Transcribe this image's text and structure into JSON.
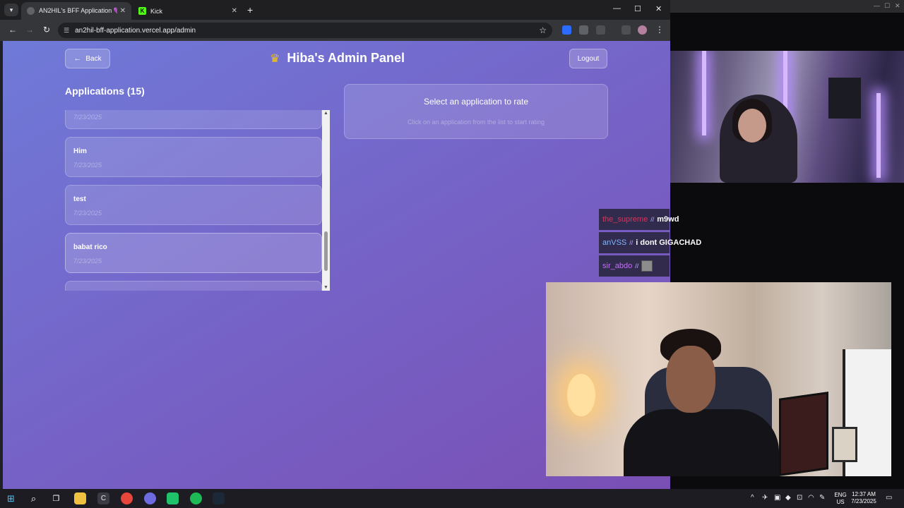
{
  "browser": {
    "tabs": [
      {
        "title": "AN2HIL's BFF Application 💜",
        "active": true
      },
      {
        "title": "Kick",
        "active": false
      }
    ],
    "url": "an2hil-bff-application.vercel.app/admin"
  },
  "page": {
    "back_label": "Back",
    "title": "Hiba's Admin Panel",
    "logout_label": "Logout",
    "applications_heading": "Applications (15)",
    "applications": [
      {
        "name": "",
        "date": "7/23/2025"
      },
      {
        "name": "Him",
        "date": "7/23/2025"
      },
      {
        "name": "test",
        "date": "7/23/2025"
      },
      {
        "name": "babat rico",
        "date": "7/23/2025"
      }
    ],
    "rate_panel": {
      "heading": "Select an application to rate",
      "subtext": "Click on an application from the list to start rating"
    }
  },
  "chat": [
    {
      "user": "the_supreme",
      "user_color": "#e0305a",
      "message": "m9wd"
    },
    {
      "user": "anVSS",
      "user_color": "#7fb7ff",
      "message": "i dont GIGACHAD"
    },
    {
      "user": "sir_abdo",
      "user_color": "#c86bff",
      "message": ""
    }
  ],
  "taskbar": {
    "lang": "ENG",
    "region": "US",
    "time": "12:37 AM",
    "date": "7/23/2025"
  },
  "colors": {
    "page_gradient_start": "#6f7ad8",
    "page_gradient_end": "#7a4fb4",
    "kick_green": "#53fc18"
  }
}
